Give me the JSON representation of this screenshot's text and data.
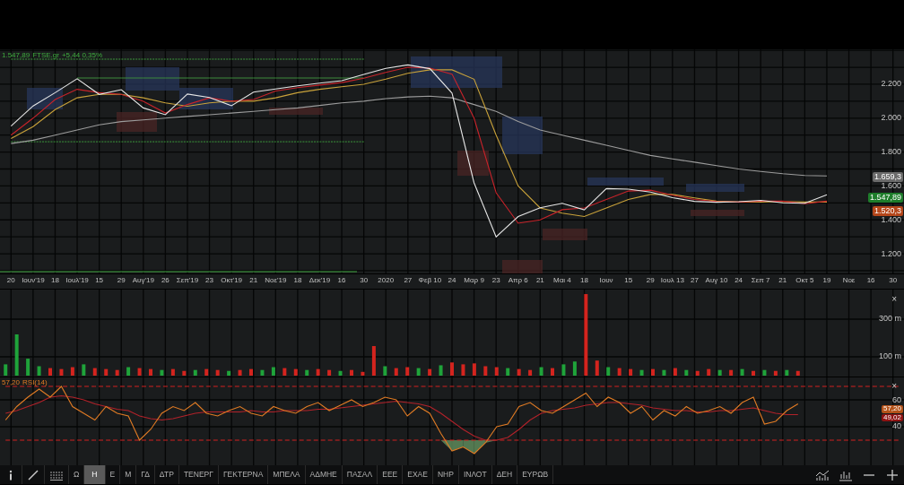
{
  "price_pane": {
    "legend": {
      "value": "1.547,89",
      "change": "+5,44 0,35%"
    },
    "chart_data": {
      "type": "line",
      "grid": true,
      "categories": [
        "20",
        "Ιουν'19",
        "18",
        "Ιουλ'19",
        "15",
        "29",
        "Αυγ'19",
        "26",
        "Σεπ'19",
        "23",
        "Οκτ'19",
        "21",
        "Νοε'19",
        "18",
        "Δεκ'19",
        "16",
        "30",
        "2020",
        "27",
        "Φεβ 10",
        "24",
        "Μαρ 9",
        "23",
        "Απρ 6",
        "21",
        "Μαι 4",
        "18",
        "Ιουν",
        "15",
        "29",
        "Ιουλ 13",
        "27",
        "Αυγ 10",
        "24",
        "Σεπ 7",
        "21",
        "Οκτ 5",
        "19",
        "Νοε",
        "16",
        "30"
      ],
      "series": [
        {
          "name": "FTSE.gr",
          "color": "#e6e6e6",
          "values": [
            1953,
            2072,
            2150,
            2232,
            2140,
            2168,
            2060,
            2020,
            2142,
            2122,
            2073,
            2153,
            2172,
            2190,
            2206,
            2221,
            2258,
            2294,
            2314,
            2292,
            2148,
            1618,
            1300,
            1420,
            1471,
            1498,
            1459,
            1584,
            1581,
            1564,
            1531,
            1509,
            1504,
            1507,
            1515,
            1500,
            1498,
            1548,
            null,
            null,
            null
          ]
        },
        {
          "color": "#c8232a",
          "values": [
            1900,
            2000,
            2110,
            2170,
            2150,
            2140,
            2100,
            2030,
            2080,
            2120,
            2100,
            2110,
            2160,
            2180,
            2195,
            2210,
            2235,
            2270,
            2300,
            2295,
            2260,
            2000,
            1560,
            1380,
            1400,
            1460,
            1470,
            1520,
            1570,
            1575,
            1545,
            1520,
            1508,
            1505,
            1510,
            1510,
            1495,
            1510,
            null,
            null,
            null
          ]
        },
        {
          "color": "#c9a23a",
          "values": [
            1880,
            1950,
            2050,
            2120,
            2140,
            2140,
            2120,
            2090,
            2070,
            2090,
            2100,
            2100,
            2120,
            2150,
            2170,
            2185,
            2200,
            2230,
            2265,
            2285,
            2285,
            2230,
            1900,
            1600,
            1470,
            1440,
            1420,
            1470,
            1520,
            1550,
            1550,
            1530,
            1510,
            1505,
            1505,
            1508,
            1505,
            1505,
            null,
            null,
            null
          ]
        },
        {
          "color": "#9c9c9c",
          "values": [
            1850,
            1870,
            1900,
            1930,
            1960,
            1980,
            1990,
            2000,
            2010,
            2020,
            2030,
            2040,
            2050,
            2060,
            2075,
            2090,
            2100,
            2115,
            2125,
            2130,
            2120,
            2080,
            2040,
            1980,
            1930,
            1900,
            1870,
            1840,
            1810,
            1780,
            1760,
            1740,
            1720,
            1700,
            1685,
            1672,
            1662,
            1659,
            null,
            null,
            null
          ]
        },
        {
          "color": "#3c9a3c",
          "line_style": "dashed",
          "values": [
            2348,
            2348,
            2348,
            2348,
            2348,
            2348,
            2348,
            2348,
            2348,
            2348,
            2348,
            2348,
            2348,
            2348,
            2348,
            2348,
            2348,
            null,
            null,
            null,
            null,
            null,
            null,
            null,
            null,
            null,
            null,
            null,
            null,
            null,
            null,
            null,
            null,
            null,
            null,
            null,
            null,
            null,
            null,
            null,
            null
          ]
        },
        {
          "color": "#3c8a3c",
          "values": [
            null,
            null,
            null,
            2237,
            2237,
            2237,
            2237,
            2237,
            2237,
            2237,
            2237,
            2237,
            2237,
            2237,
            2237,
            2237,
            2237,
            null,
            null,
            null,
            null,
            null,
            null,
            null,
            null,
            null,
            null,
            null,
            null,
            null,
            null,
            null,
            null,
            null,
            null,
            null,
            null,
            null,
            null,
            null,
            null
          ]
        },
        {
          "color": "#3c9a3c",
          "line_style": "dashed",
          "values": [
            1861,
            1861,
            1861,
            1861,
            1861,
            1861,
            1861,
            1861,
            1861,
            1861,
            1861,
            1861,
            1861,
            1861,
            1861,
            1861,
            1861,
            null,
            null,
            null,
            null,
            null,
            null,
            null,
            null,
            null,
            null,
            null,
            null,
            null,
            null,
            null,
            null,
            null,
            null,
            null,
            null,
            null,
            null,
            null,
            null
          ]
        }
      ],
      "ylim": [
        1084,
        2406
      ],
      "yticks": [
        {
          "value": 2200,
          "label": "2.200"
        },
        {
          "value": 2000,
          "label": "2.000"
        },
        {
          "value": 1800,
          "label": "1.800"
        },
        {
          "value": 1600,
          "label": "1.600"
        },
        {
          "value": 1400,
          "label": "1.400"
        },
        {
          "value": 1200,
          "label": "1.200"
        }
      ]
    },
    "badges": [
      {
        "text": "1.659,3",
        "color": "#6b6b6b"
      },
      {
        "text": "1.547,89",
        "color": "#1e7d2b"
      },
      {
        "text": "1.520,3",
        "color": "#b4461a"
      }
    ]
  },
  "volume_pane": {
    "close": "×",
    "chart_data": {
      "type": "bar",
      "grid": true,
      "categories": [
        null,
        null,
        null,
        null,
        null,
        null,
        null,
        null,
        null,
        null,
        null,
        null,
        null,
        null,
        null,
        null,
        null,
        null,
        null,
        null,
        null,
        null,
        null,
        null,
        null,
        null,
        null,
        null,
        null,
        null,
        null,
        null,
        null,
        null,
        null,
        null,
        null,
        null,
        null,
        null,
        null,
        null,
        null,
        null,
        null,
        null,
        null,
        null,
        null,
        null,
        null,
        null,
        null,
        null,
        null,
        null,
        null,
        null,
        null,
        null,
        null,
        null,
        null,
        null,
        null,
        null,
        null,
        null,
        null,
        null,
        null,
        null,
        null,
        null,
        null,
        null,
        null,
        null,
        null,
        null,
        null
      ],
      "series": [
        {
          "color": "#1fa33a",
          "values": [
            60,
            219,
            90,
            50,
            null,
            null,
            null,
            60,
            null,
            null,
            null,
            45,
            null,
            null,
            30,
            null,
            null,
            30,
            null,
            null,
            25,
            null,
            null,
            30,
            45,
            null,
            null,
            30,
            null,
            null,
            25,
            null,
            null,
            null,
            50,
            null,
            null,
            40,
            null,
            55,
            null,
            null,
            null,
            null,
            null,
            40,
            null,
            null,
            45,
            null,
            60,
            75,
            null,
            null,
            45,
            null,
            null,
            30,
            null,
            30,
            null,
            30,
            null,
            null,
            30,
            null,
            35,
            null,
            30,
            null,
            30,
            null,
            null,
            null,
            null,
            null,
            null,
            null,
            null,
            null,
            null
          ]
        },
        {
          "color": "#d4241e",
          "values": [
            null,
            null,
            null,
            null,
            40,
            35,
            45,
            null,
            40,
            35,
            30,
            null,
            40,
            35,
            null,
            35,
            25,
            null,
            35,
            30,
            null,
            30,
            35,
            null,
            null,
            40,
            35,
            null,
            35,
            30,
            null,
            30,
            20,
            157,
            null,
            40,
            45,
            null,
            35,
            null,
            70,
            60,
            65,
            50,
            45,
            null,
            35,
            30,
            null,
            40,
            null,
            null,
            433,
            80,
            null,
            40,
            35,
            null,
            35,
            null,
            40,
            null,
            25,
            35,
            null,
            30,
            null,
            25,
            null,
            25,
            null,
            25,
            null,
            null,
            null,
            null,
            null,
            null,
            null,
            null,
            null
          ]
        }
      ],
      "ylim": [
        0,
        457
      ],
      "yticks": [
        {
          "value": 300,
          "label": "300 m"
        },
        {
          "value": 100,
          "label": "100 m"
        }
      ]
    }
  },
  "rsi_pane": {
    "legend": {
      "value": "57,20"
    },
    "close": "×",
    "chart_data": {
      "type": "line",
      "grid": true,
      "categories": [
        null,
        null,
        null,
        null,
        null,
        null,
        null,
        null,
        null,
        null,
        null,
        null,
        null,
        null,
        null,
        null,
        null,
        null,
        null,
        null,
        null,
        null,
        null,
        null,
        null,
        null,
        null,
        null,
        null,
        null,
        null,
        null,
        null,
        null,
        null,
        null,
        null,
        null,
        null,
        null,
        null,
        null,
        null,
        null,
        null,
        null,
        null,
        null,
        null,
        null,
        null,
        null,
        null,
        null,
        null,
        null,
        null,
        null,
        null,
        null,
        null,
        null,
        null,
        null,
        null,
        null,
        null,
        null,
        null,
        null,
        null,
        null,
        null,
        null,
        null,
        null,
        null,
        null,
        null,
        null,
        null
      ],
      "series": [
        {
          "name": "RSI(14)",
          "color": "#e07b24",
          "values": [
            45,
            55,
            62,
            68,
            62,
            70,
            55,
            50,
            45,
            55,
            50,
            48,
            30,
            38,
            50,
            55,
            52,
            58,
            50,
            48,
            52,
            55,
            50,
            48,
            55,
            52,
            50,
            55,
            58,
            52,
            56,
            60,
            55,
            58,
            62,
            60,
            48,
            55,
            50,
            35,
            22,
            25,
            20,
            28,
            40,
            42,
            55,
            58,
            52,
            50,
            55,
            60,
            65,
            55,
            62,
            58,
            50,
            55,
            45,
            52,
            48,
            55,
            50,
            52,
            55,
            50,
            58,
            62,
            42,
            44,
            52,
            57,
            null,
            null,
            null,
            null,
            null,
            null,
            null,
            null,
            null
          ]
        },
        {
          "color": "#b3222a",
          "values": [
            50,
            52,
            55,
            58,
            62,
            63,
            62,
            60,
            57,
            55,
            53,
            52,
            48,
            46,
            45,
            46,
            48,
            50,
            51,
            51,
            51,
            51,
            52,
            51,
            51,
            52,
            52,
            52,
            53,
            53,
            54,
            55,
            56,
            57,
            58,
            59,
            58,
            57,
            55,
            50,
            44,
            38,
            33,
            30,
            30,
            32,
            38,
            45,
            50,
            52,
            53,
            54,
            56,
            57,
            58,
            58,
            57,
            56,
            54,
            53,
            52,
            52,
            51,
            51,
            52,
            52,
            53,
            54,
            52,
            50,
            49,
            49,
            null,
            null,
            null,
            null,
            null,
            null,
            null,
            null,
            null
          ]
        },
        {
          "color": "#d22020",
          "line_style": "dashed",
          "values": [
            70,
            70,
            70,
            70,
            70,
            70,
            70,
            70,
            70,
            70,
            70,
            70,
            70,
            70,
            70,
            70,
            70,
            70,
            70,
            70,
            70,
            70,
            70,
            70,
            70,
            70,
            70,
            70,
            70,
            70,
            70,
            70,
            70,
            70,
            70,
            70,
            70,
            70,
            70,
            70,
            70,
            70,
            70,
            70,
            70,
            70,
            70,
            70,
            70,
            70,
            70,
            70,
            70,
            70,
            70,
            70,
            70,
            70,
            70,
            70,
            70,
            70,
            70,
            70,
            70,
            70,
            70,
            70,
            70,
            70,
            70,
            70,
            70,
            70,
            70,
            70,
            70,
            70,
            70,
            70,
            70
          ]
        },
        {
          "color": "#d22020",
          "line_style": "dashed",
          "values": [
            30,
            30,
            30,
            30,
            30,
            30,
            30,
            30,
            30,
            30,
            30,
            30,
            30,
            30,
            30,
            30,
            30,
            30,
            30,
            30,
            30,
            30,
            30,
            30,
            30,
            30,
            30,
            30,
            30,
            30,
            30,
            30,
            30,
            30,
            30,
            30,
            30,
            30,
            30,
            30,
            30,
            30,
            30,
            30,
            30,
            30,
            30,
            30,
            30,
            30,
            30,
            30,
            30,
            30,
            30,
            30,
            30,
            30,
            30,
            30,
            30,
            30,
            30,
            30,
            30,
            30,
            30,
            30,
            30,
            30,
            30,
            30,
            30,
            30,
            30,
            30,
            30,
            30,
            30,
            30,
            30
          ]
        }
      ],
      "ylim": [
        11.3,
        76.7
      ],
      "yticks": [
        60,
        40
      ]
    },
    "readings": [
      {
        "text": "57,20",
        "color": "#b4531a"
      },
      {
        "text": "49,02",
        "color": "#8e1212"
      }
    ]
  },
  "toolbar": {
    "tabs": [
      {
        "label": "Ω",
        "selected": false
      },
      {
        "label": "Η",
        "selected": true
      },
      {
        "label": "Ε",
        "selected": false
      },
      {
        "label": "Μ",
        "selected": false
      },
      {
        "label": "ΓΔ",
        "selected": false
      },
      {
        "label": "ΔΤΡ",
        "selected": false
      },
      {
        "label": "ΤΕΝΕΡΓ",
        "selected": false
      },
      {
        "label": "ΓΕΚΤΕΡΝΑ",
        "selected": false
      },
      {
        "label": "ΜΠΕΛΑ",
        "selected": false
      },
      {
        "label": "ΑΔΜΗΕ",
        "selected": false
      },
      {
        "label": "ΠΑΣΑΛ",
        "selected": false
      },
      {
        "label": "ΕΕΕ",
        "selected": false
      },
      {
        "label": "ΕΧΑΕ",
        "selected": false
      },
      {
        "label": "ΝΗΡ",
        "selected": false
      },
      {
        "label": "ΙΝΛΟΤ",
        "selected": false
      },
      {
        "label": "ΔΕΗ",
        "selected": false
      },
      {
        "label": "ΕΥΡΩΒ",
        "selected": false
      }
    ]
  }
}
